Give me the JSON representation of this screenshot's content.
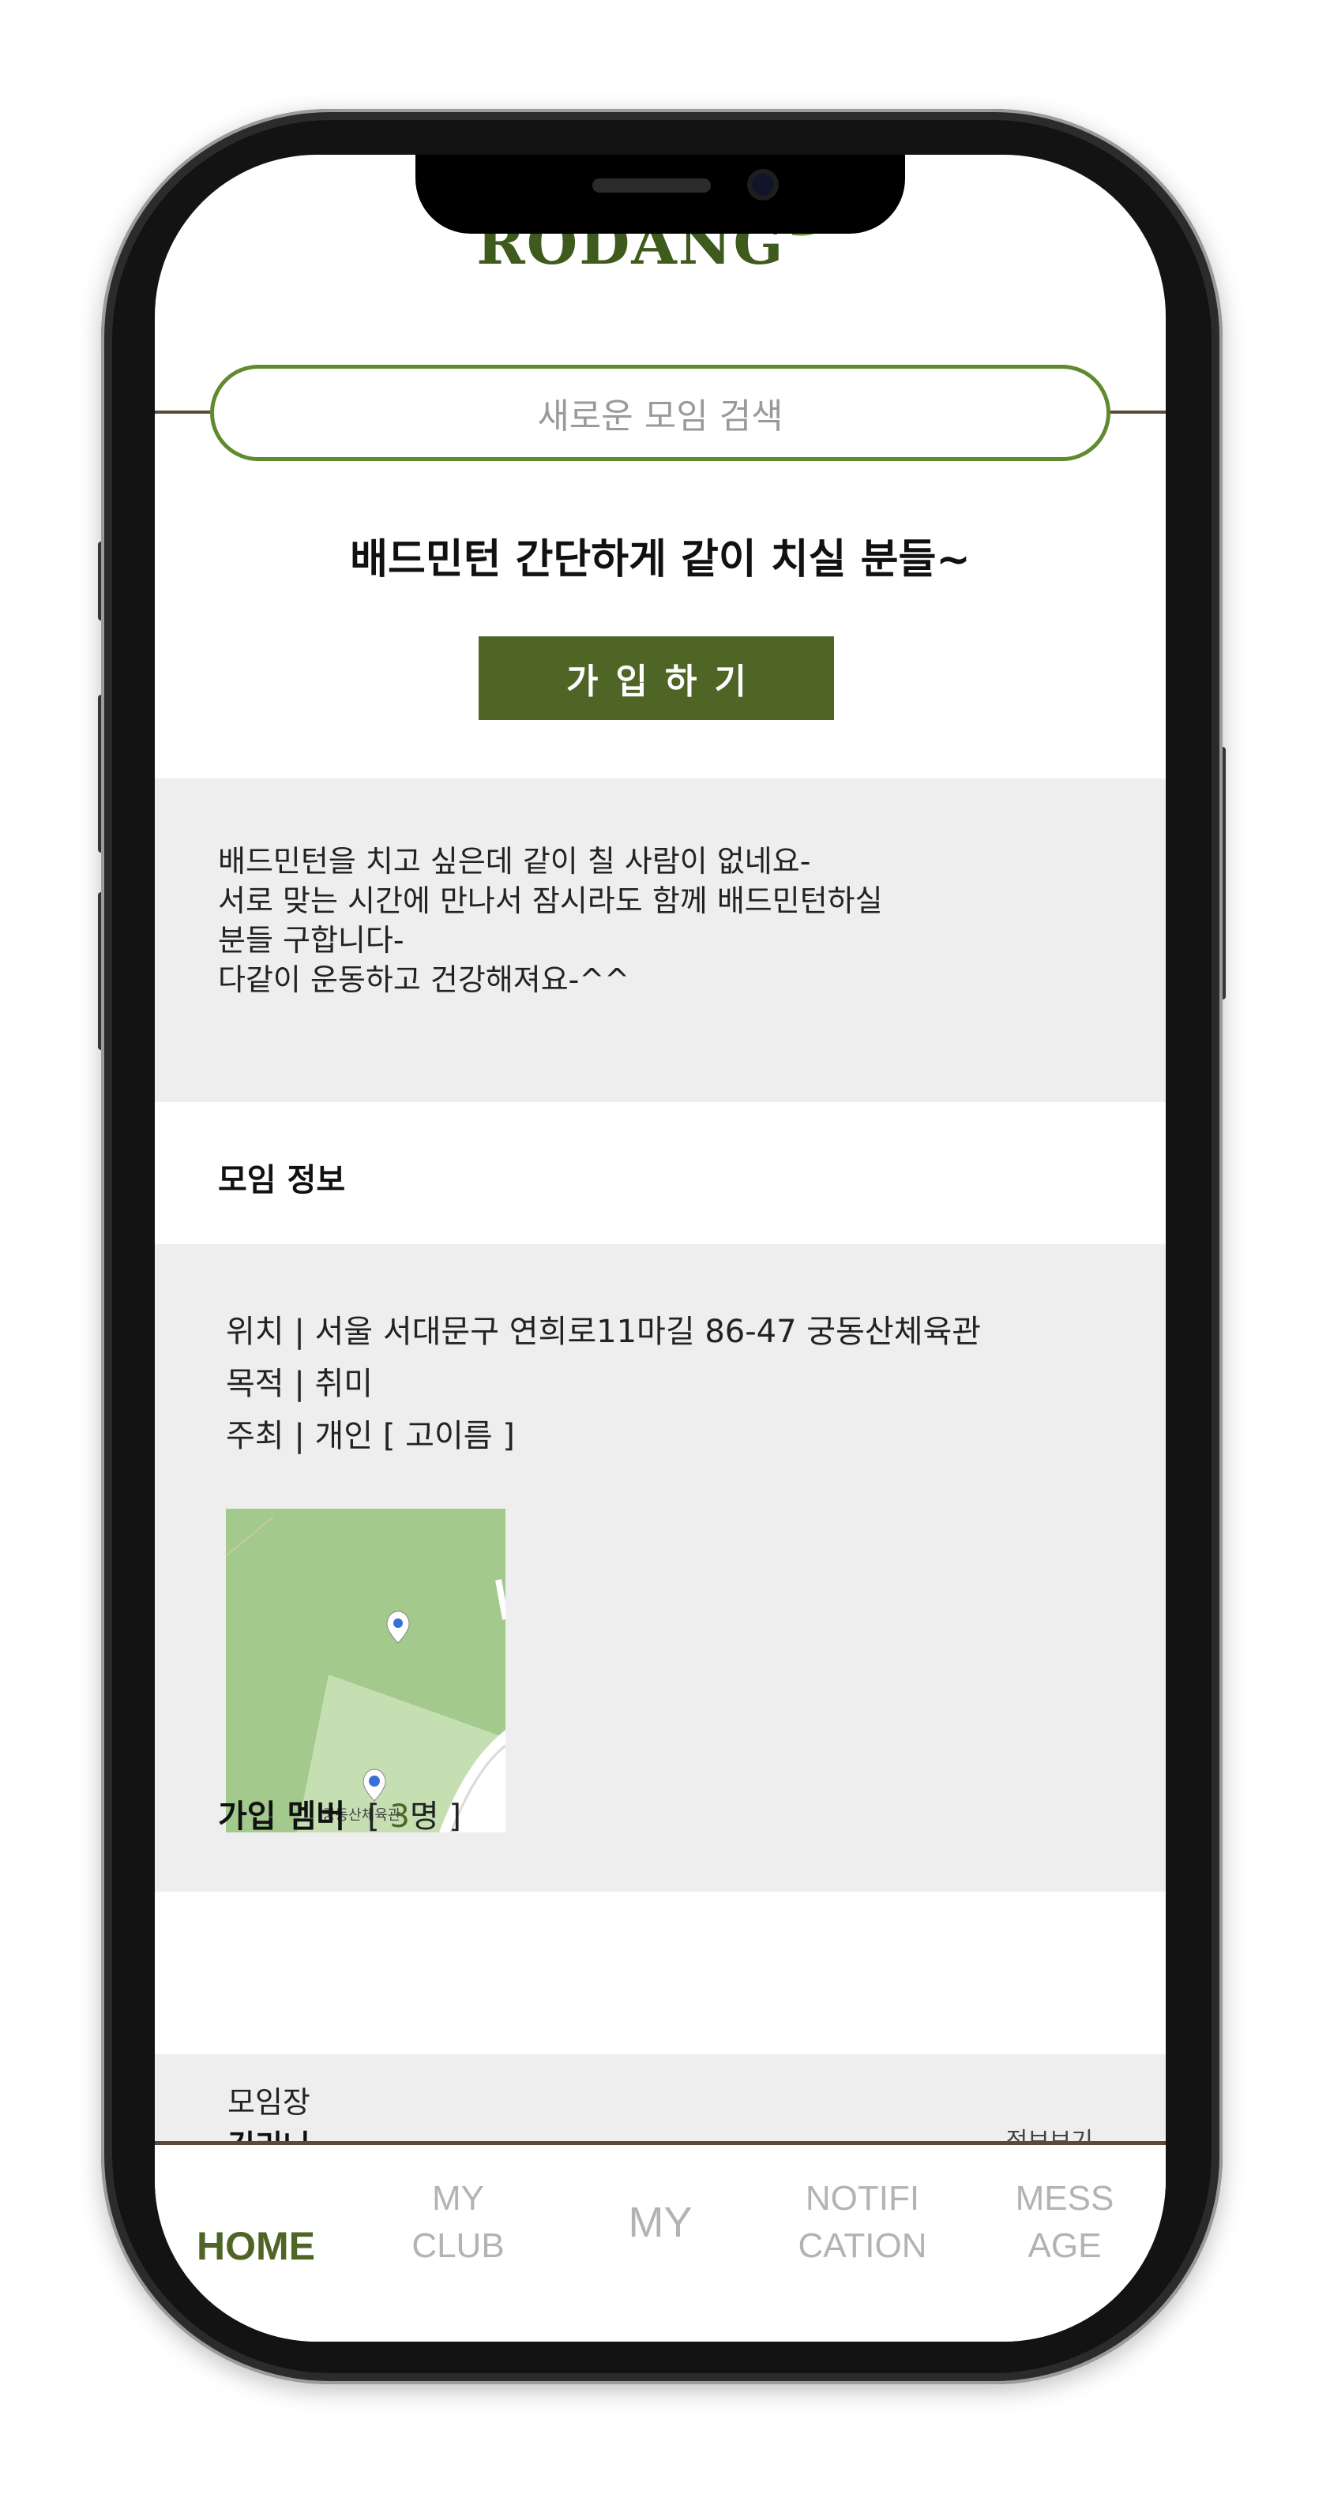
{
  "app": {
    "logo": "RODANG"
  },
  "search": {
    "placeholder": "새로운 모임 검색"
  },
  "club": {
    "title": "배드민턴 간단하게 같이 치실 분들~",
    "join_label": "가입하기",
    "description": [
      "배드민턴을 치고 싶은데 같이 칠 사람이 없네요-",
      "서로 맞는 시간에 만나서 잠시라도 함께 배드민턴하실",
      "분들 구합니다-",
      "다같이 운동하고 건강해져요-^^"
    ]
  },
  "info": {
    "heading": "모임 정보",
    "location": "위치 | 서울 서대문구 연희로11마길 86-47 궁동산체육관",
    "purpose": "목적 | 취미",
    "host": "주최 | 개인 [ 고이름 ]",
    "map_label": "궁동산체육관"
  },
  "members": {
    "heading": "가입 멤버",
    "count_open": "[",
    "count": "3",
    "count_unit": "명",
    "count_close": "]",
    "leader_label": "모임장",
    "leader_name": "김리니",
    "leader_link": "정보보기"
  },
  "nav": {
    "home": "HOME",
    "myclub_line1": "MY",
    "myclub_line2": "CLUB",
    "my": "MY",
    "notification_line1": "NOTIFI",
    "notification_line2": "CATION",
    "message_line1": "MESS",
    "message_line2": "AGE"
  },
  "colors": {
    "accent": "#4f6526",
    "search_border": "#5f8a2f",
    "divider": "#5b4b34",
    "gray_block": "#eeeeee",
    "nav_inactive": "#b3b3b3"
  }
}
